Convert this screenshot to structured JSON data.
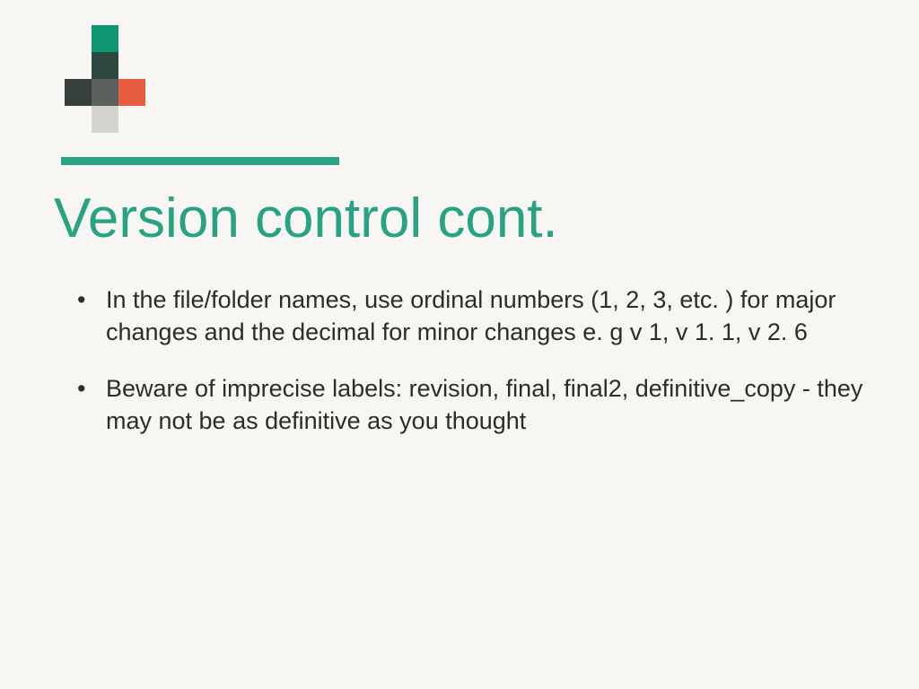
{
  "slide": {
    "title": "Version control cont.",
    "bullets": [
      "In the file/folder names, use ordinal numbers (1, 2, 3, etc. ) for major changes and the decimal for minor changes e. g v 1, v 1. 1, v 2. 6",
      "Beware of imprecise labels: revision, final, final2, definitive_copy - they may not be as definitive as you thought"
    ]
  },
  "logo": {
    "blocks": [
      {
        "class": "b1"
      },
      {
        "class": "b2"
      },
      {
        "class": "b3"
      },
      {
        "class": "b4"
      },
      {
        "class": "b5"
      },
      {
        "class": "b6"
      }
    ]
  }
}
